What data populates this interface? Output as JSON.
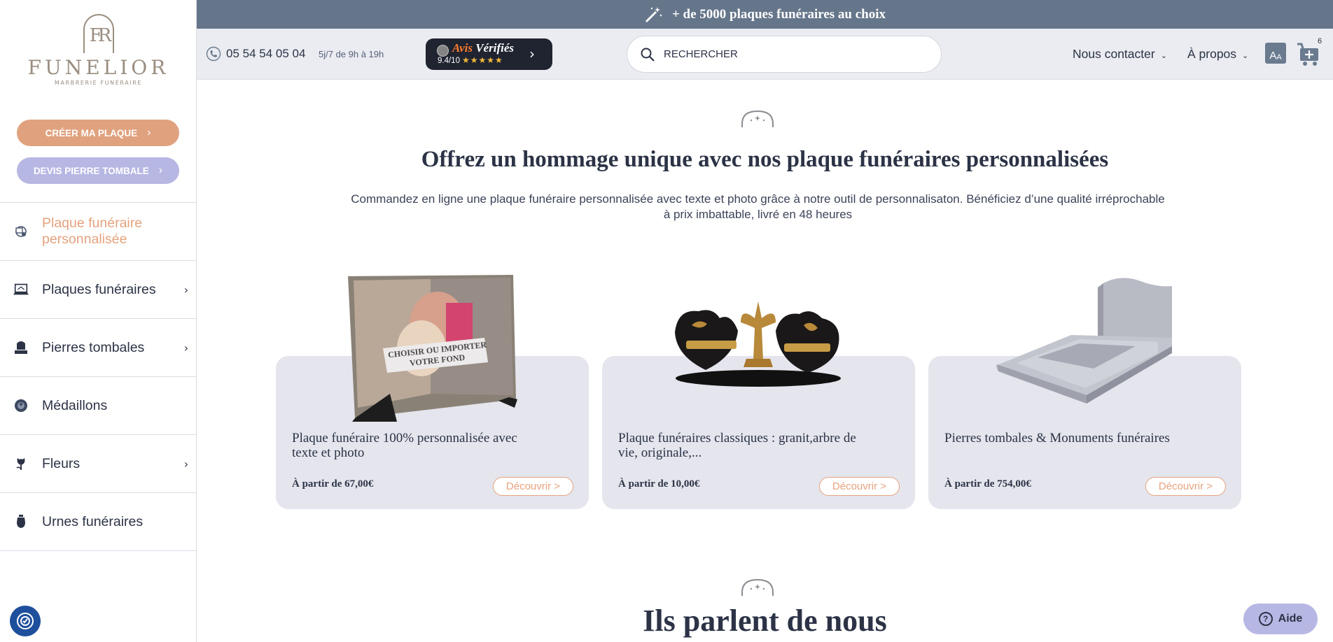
{
  "brand": {
    "logo_letters": "FR",
    "name": "FUNELIOR",
    "tagline": "MARBRERIE FUNÉRAIRE"
  },
  "sidebar": {
    "create_button": "CRÉER MA PLAQUE",
    "devis_button": "DEVIS PIERRE TOMBALE",
    "items": [
      {
        "label": "Plaque funéraire personnalisée",
        "icon": "custom-plaque-icon",
        "active": true,
        "has_arrow": false
      },
      {
        "label": "Plaques funéraires",
        "icon": "plaque-icon",
        "active": false,
        "has_arrow": true
      },
      {
        "label": "Pierres tombales",
        "icon": "tombstone-icon",
        "active": false,
        "has_arrow": true
      },
      {
        "label": "Médaillons",
        "icon": "medallion-icon",
        "active": false,
        "has_arrow": false
      },
      {
        "label": "Fleurs",
        "icon": "flower-icon",
        "active": false,
        "has_arrow": true
      },
      {
        "label": "Urnes funéraires",
        "icon": "urn-icon",
        "active": false,
        "has_arrow": false
      }
    ]
  },
  "promo": {
    "text": "+ de 5000 plaques funéraires au choix",
    "icon": "magic-wand-icon"
  },
  "header": {
    "phone": "05 54 54 05 04",
    "hours": "5j/7 de 9h à 19h",
    "reviews": {
      "title_prefix": "Avis",
      "title_main": "Vérifiés",
      "score": "9.4/10",
      "stars": "★★★★★"
    },
    "search_placeholder": "RECHERCHER",
    "nav_contact": "Nous contacter",
    "nav_about": "À propos",
    "font_button": "A",
    "font_button_small": "A",
    "cart_count": "6"
  },
  "main": {
    "title": "Offrez un hommage unique avec nos plaque funéraires personnalisées",
    "description": "Commandez en ligne une plaque funéraire personnalisée avec texte et photo grâce à notre outil de personnalisaton. Bénéficiez d’une qualité irréprochable à prix imbattable, livré en 48 heures",
    "cards": [
      {
        "title": "Plaque funéraire 100% personnalisée avec texte et photo",
        "price": "À partir de 67,00€",
        "button": "Découvrir >",
        "image_text": "CHOISIR OU IMPORTER VOTRE FOND"
      },
      {
        "title": "Plaque funéraires classiques : granit,arbre de vie, originale,...",
        "price": "À partir de 10,00€",
        "button": "Découvrir >"
      },
      {
        "title": "Pierres tombales & Monuments funéraires",
        "price": "À partir de 754,00€",
        "button": "Découvrir >"
      }
    ],
    "section2_title": "Ils parlent de nous"
  },
  "help_button": "Aide",
  "colors": {
    "accent_orange": "#e0a27e",
    "accent_lavender": "#b7b7e4",
    "promo_bar": "#65758a",
    "text_dark": "#2c3346"
  }
}
